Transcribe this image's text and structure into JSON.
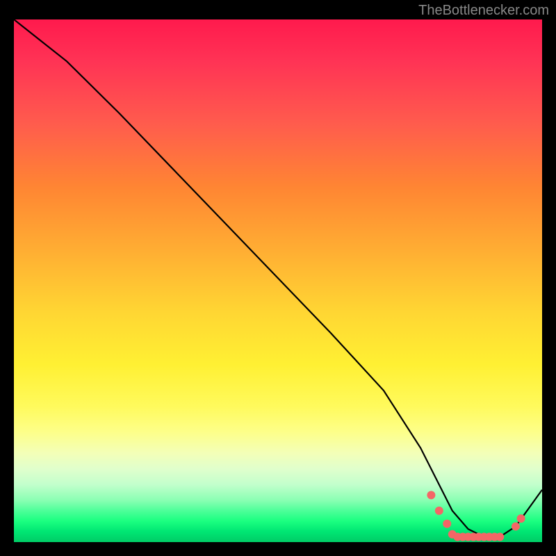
{
  "attribution": "TheBottlenecker.com",
  "chart_data": {
    "type": "line",
    "title": "",
    "xlabel": "",
    "ylabel": "",
    "xlim": [
      0,
      100
    ],
    "ylim": [
      0,
      100
    ],
    "series": [
      {
        "name": "curve",
        "x": [
          0,
          5,
          10,
          20,
          30,
          40,
          50,
          60,
          70,
          77,
          80,
          83,
          86,
          89,
          92,
          95,
          100
        ],
        "y": [
          100,
          96,
          92,
          82,
          71.5,
          61,
          50.5,
          40,
          29,
          18,
          12,
          6,
          2.5,
          1,
          1,
          3,
          10
        ]
      }
    ],
    "markers": [
      {
        "x": 79,
        "y": 9
      },
      {
        "x": 80.5,
        "y": 6
      },
      {
        "x": 82,
        "y": 3.5
      },
      {
        "x": 83,
        "y": 1.5
      },
      {
        "x": 84,
        "y": 1
      },
      {
        "x": 85,
        "y": 1
      },
      {
        "x": 86,
        "y": 1
      },
      {
        "x": 87,
        "y": 1
      },
      {
        "x": 88,
        "y": 1
      },
      {
        "x": 89,
        "y": 1
      },
      {
        "x": 90,
        "y": 1
      },
      {
        "x": 91,
        "y": 1
      },
      {
        "x": 92,
        "y": 1
      },
      {
        "x": 95,
        "y": 3
      },
      {
        "x": 96,
        "y": 4.5
      }
    ],
    "colors": {
      "curve": "#000000",
      "marker": "#f46666"
    }
  }
}
